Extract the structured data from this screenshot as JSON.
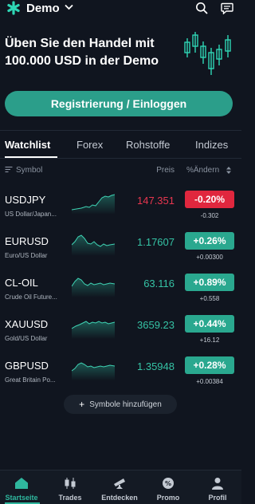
{
  "header": {
    "account_label": "Demo",
    "logo_icon": "asterisk-logo",
    "search_icon": "search-icon",
    "chat_icon": "chat-icon"
  },
  "banner": {
    "headline_line1": "Üben Sie den Handel mit",
    "headline_line2": "100.000 USD in der Demo",
    "cta_label": "Registrierung / Einloggen"
  },
  "tabs": [
    {
      "label": "Watchlist",
      "active": true
    },
    {
      "label": "Forex",
      "active": false
    },
    {
      "label": "Rohstoffe",
      "active": false
    },
    {
      "label": "Indizes",
      "active": false
    }
  ],
  "columns": {
    "symbol": "Symbol",
    "price": "Preis",
    "change": "%Ändern"
  },
  "instruments": [
    {
      "symbol": "USDJPY",
      "description": "US Dollar/Japan...",
      "price": "147.351",
      "change_pct": "-0.20%",
      "change_abs": "-0.302",
      "direction": "down"
    },
    {
      "symbol": "EURUSD",
      "description": "Euro/US Dollar",
      "price": "1.17607",
      "change_pct": "+0.26%",
      "change_abs": "+0.00300",
      "direction": "up"
    },
    {
      "symbol": "CL-OIL",
      "description": "Crude Oil Future...",
      "price": "63.116",
      "change_pct": "+0.89%",
      "change_abs": "+0.558",
      "direction": "up"
    },
    {
      "symbol": "XAUUSD",
      "description": "Gold/US Dollar",
      "price": "3659.23",
      "change_pct": "+0.44%",
      "change_abs": "+16.12",
      "direction": "up"
    },
    {
      "symbol": "GBPUSD",
      "description": "Great Britain Po...",
      "price": "1.35948",
      "change_pct": "+0.28%",
      "change_abs": "+0.00384",
      "direction": "up"
    }
  ],
  "add_symbols_label": "Symbole hinzufügen",
  "bottom_nav": [
    {
      "label": "Startseite",
      "icon": "home-icon",
      "active": true
    },
    {
      "label": "Trades",
      "icon": "candlestick-icon",
      "active": false
    },
    {
      "label": "Entdecken",
      "icon": "telescope-icon",
      "active": false
    },
    {
      "label": "Promo",
      "icon": "promo-icon",
      "active": false
    },
    {
      "label": "Profil",
      "icon": "user-icon",
      "active": false
    }
  ],
  "colors": {
    "background": "#10151f",
    "accent": "#2b9e8a",
    "up": "#2aa88f",
    "down": "#e0273e"
  }
}
